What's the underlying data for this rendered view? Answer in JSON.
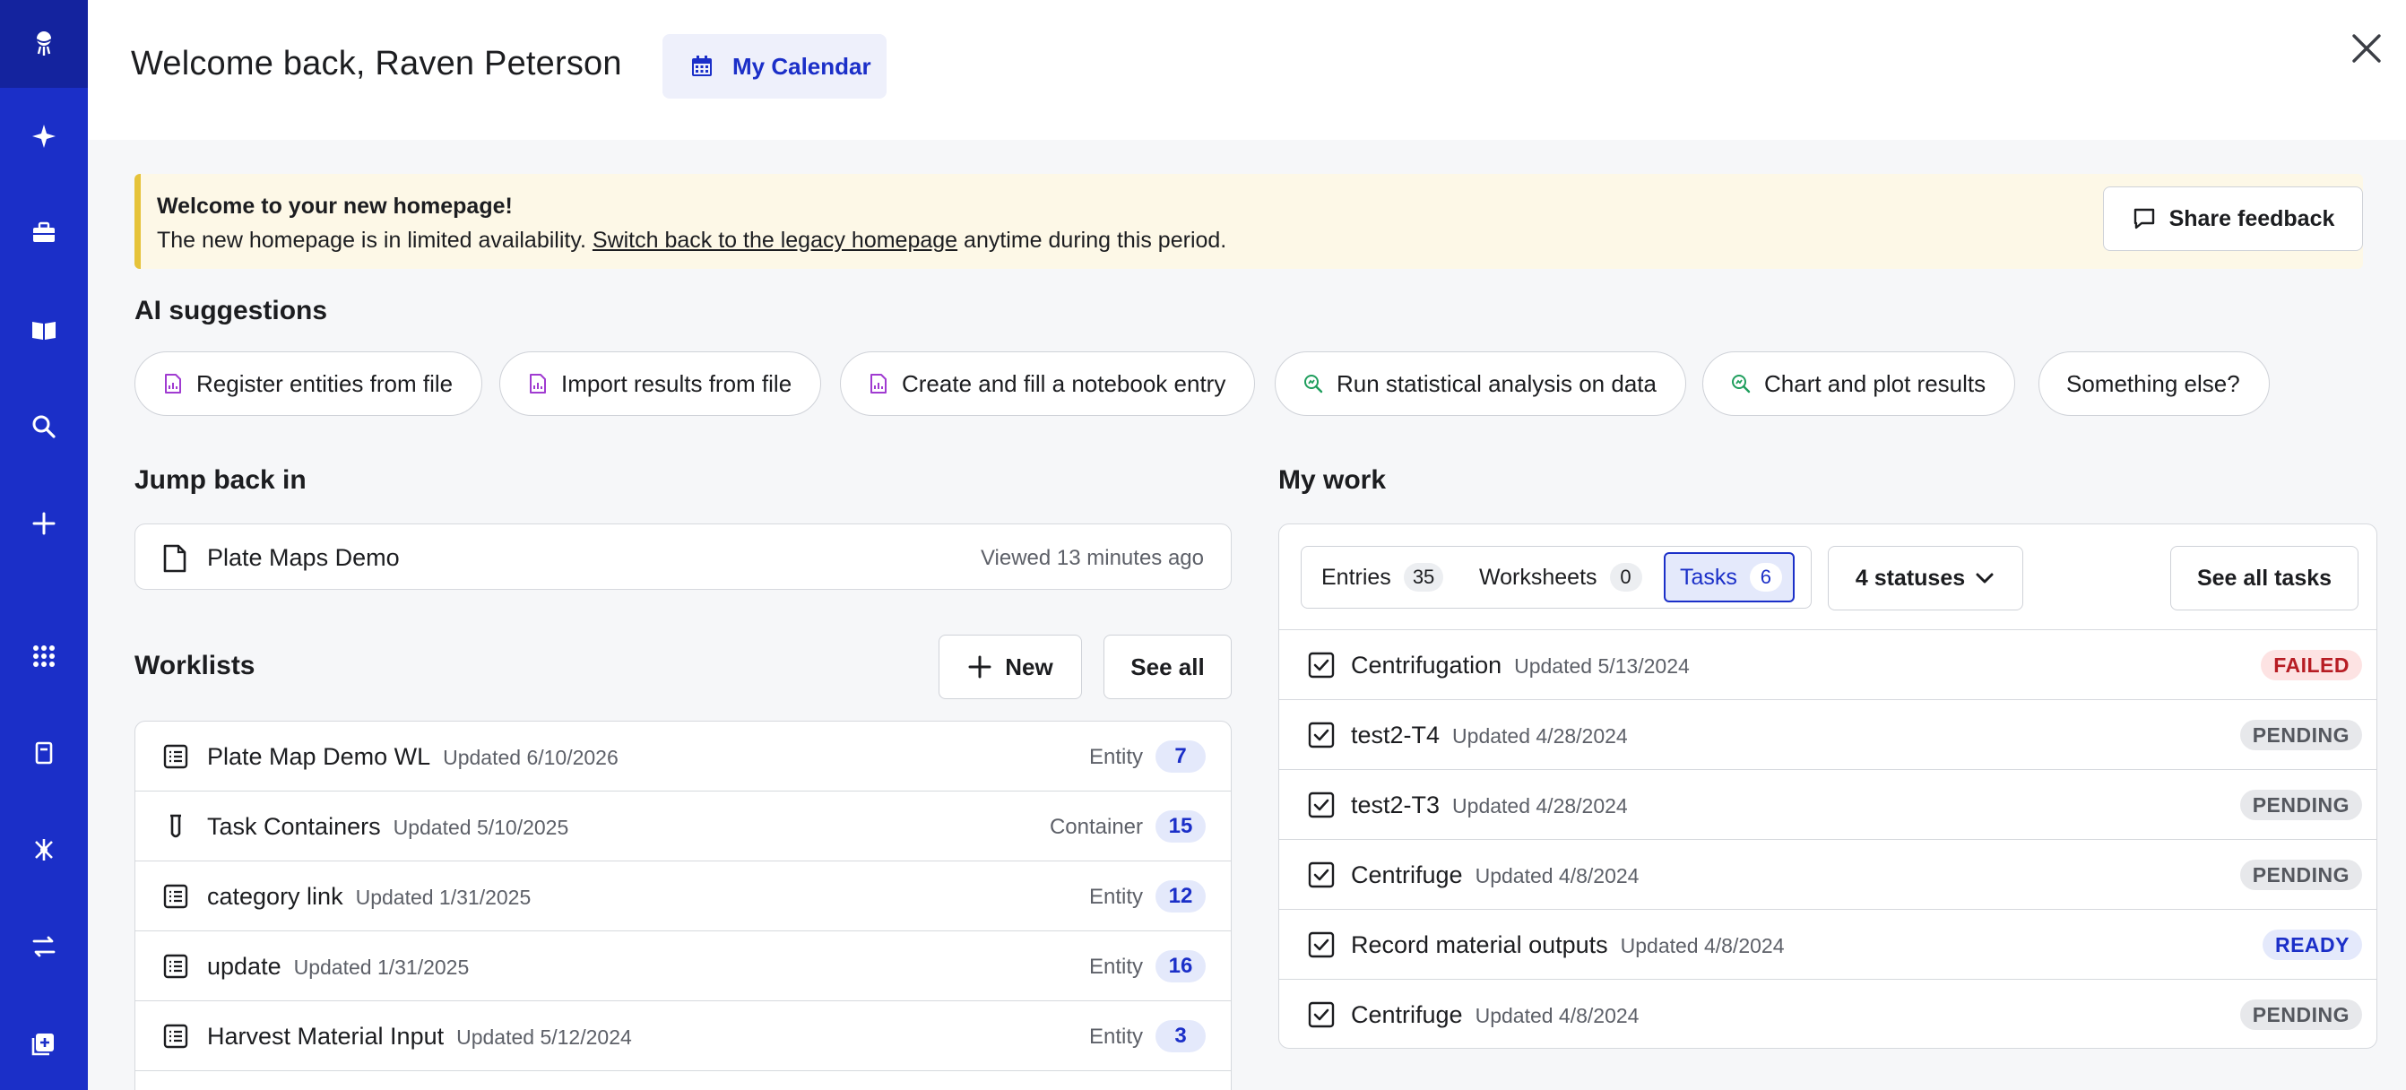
{
  "header": {
    "welcome": "Welcome back, Raven Peterson",
    "calendar_label": "My Calendar"
  },
  "banner": {
    "title": "Welcome to your new homepage!",
    "text_before": "The new homepage is in limited availability. ",
    "link": "Switch back to the legacy homepage",
    "text_after": " anytime during this period.",
    "feedback_label": "Share feedback"
  },
  "ai": {
    "title": "AI suggestions",
    "chips": [
      {
        "label": "Register entities from file",
        "icon": "file-chart-icon"
      },
      {
        "label": "Import results from file",
        "icon": "file-chart-icon"
      },
      {
        "label": "Create and fill a notebook entry",
        "icon": "file-chart-icon"
      },
      {
        "label": "Run statistical analysis on data",
        "icon": "magnify-chart-icon"
      },
      {
        "label": "Chart and plot results",
        "icon": "magnify-chart-icon"
      },
      {
        "label": "Something else?",
        "icon": ""
      }
    ]
  },
  "jump": {
    "title": "Jump back in",
    "item_name": "Plate Maps Demo",
    "item_when": "Viewed 13 minutes ago"
  },
  "worklists": {
    "title": "Worklists",
    "new_label": "New",
    "see_all_label": "See all",
    "rows": [
      {
        "name": "Plate Map Demo WL",
        "updated": "Updated 6/10/2026",
        "type": "Entity",
        "count": "7"
      },
      {
        "name": "Task Containers",
        "updated": "Updated 5/10/2025",
        "type": "Container",
        "count": "15"
      },
      {
        "name": "category link",
        "updated": "Updated 1/31/2025",
        "type": "Entity",
        "count": "12"
      },
      {
        "name": "update",
        "updated": "Updated 1/31/2025",
        "type": "Entity",
        "count": "16"
      },
      {
        "name": "Harvest Material Input",
        "updated": "Updated 5/12/2024",
        "type": "Entity",
        "count": "3"
      }
    ]
  },
  "mywork": {
    "title": "My work",
    "tabs": [
      {
        "label": "Entries",
        "count": "35"
      },
      {
        "label": "Worksheets",
        "count": "0"
      },
      {
        "label": "Tasks",
        "count": "6"
      }
    ],
    "status_filter": "4 statuses",
    "see_all_tasks": "See all tasks",
    "tasks": [
      {
        "name": "Centrifugation",
        "updated": "Updated 5/13/2024",
        "status": "FAILED"
      },
      {
        "name": "test2-T4",
        "updated": "Updated 4/28/2024",
        "status": "PENDING"
      },
      {
        "name": "test2-T3",
        "updated": "Updated 4/28/2024",
        "status": "PENDING"
      },
      {
        "name": "Centrifuge",
        "updated": "Updated 4/8/2024",
        "status": "PENDING"
      },
      {
        "name": "Record material outputs",
        "updated": "Updated 4/8/2024",
        "status": "READY"
      },
      {
        "name": "Centrifuge",
        "updated": "Updated 4/8/2024",
        "status": "PENDING"
      }
    ]
  },
  "colors": {
    "nav": "#1b2fc8",
    "accent": "#1b2fc8",
    "banner_bg": "#fdf8e7",
    "banner_bar": "#e6c33a",
    "failed": "#b71d24"
  }
}
